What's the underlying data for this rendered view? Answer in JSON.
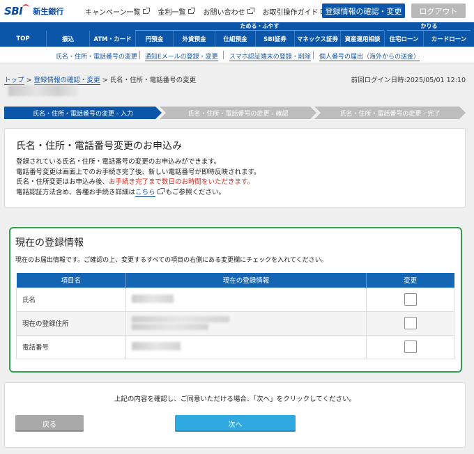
{
  "header": {
    "logo_text": "SBI",
    "bank_name": "新生銀行",
    "links": [
      "キャンペーン一覧",
      "金利一覧",
      "お問い合わせ",
      "お取引操作ガイド"
    ],
    "confirm_button": "登録情報の確認・変更",
    "logout_button": "ログアウト"
  },
  "nav": {
    "group_save": "ためる・ふやす",
    "group_borrow": "かりる",
    "items": [
      "TOP",
      "振込",
      "ATM・カード",
      "円預金",
      "外貨預金",
      "仕組預金",
      "SBI証券",
      "マネックス証券",
      "資産運用相談",
      "住宅ローン",
      "カードローン"
    ]
  },
  "subnav": {
    "items": [
      "氏名・住所・電話番号の変更",
      "通知Eメールの登録・変更",
      "スマホ認証端末の登録・削除",
      "個人番号の届出（海外からの送金）"
    ]
  },
  "breadcrumb": {
    "top": "トップ",
    "sep": ">",
    "level2": "登録情報の確認・変更",
    "current": "氏名・住所・電話番号の変更"
  },
  "last_login": "前回ログイン日時:2025/05/01 12:10",
  "steps": [
    "氏名・住所・電話番号の変更 - 入力",
    "氏名・住所・電話番号の変更 - 確認",
    "氏名・住所・電話番号の変更 - 完了"
  ],
  "intro": {
    "title": "氏名・住所・電話番号変更のお申込み",
    "line1": "登録されている氏名・住所・電話番号の変更のお申込みができます。",
    "line2": "電話番号変更は画面上でのお手続き完了後、新しい電話番号が即時反映されます。",
    "line3_a": "氏名・住所変更はお申込み後、",
    "line3_b": "お手続き完了まで数日のお時間をいただきます。",
    "line4_a": "電話認証方法含め、各種お手続き詳細は",
    "line4_link": "こちら",
    "line4_b": "もご参照ください。"
  },
  "current_info": {
    "title": "現在の登録情報",
    "desc": "現在のお届出情報です。ご確認の上、変更するすべての項目の右側にある変更欄にチェックを入れてください。",
    "headers": [
      "項目名",
      "現在の登録情報",
      "変更"
    ],
    "rows": [
      {
        "label": "氏名"
      },
      {
        "label": "現在の登録住所"
      },
      {
        "label": "電話番号"
      }
    ]
  },
  "footer": {
    "note": "上記の内容を確認し、ご同意いただける場合、「次へ」をクリックしてください。",
    "back": "戻る",
    "next": "次へ"
  }
}
